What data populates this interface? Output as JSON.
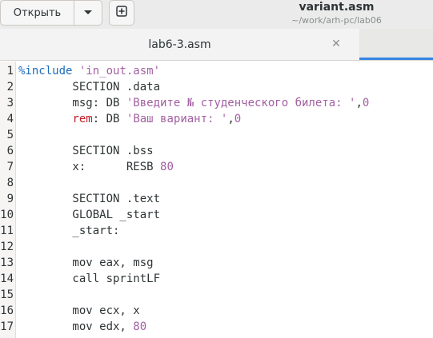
{
  "toolbar": {
    "open_label": "Открыть",
    "open_menu_icon": "chevron-down-icon",
    "new_tab_icon": "new-document-plus-icon"
  },
  "window": {
    "title": "variant.asm",
    "subtitle": "~/work/arh-pc/lab06"
  },
  "tabs": [
    {
      "label": "lab6-3.asm",
      "close_icon": "close-icon"
    }
  ],
  "editor": {
    "lines": [
      {
        "n": "1",
        "text": "%include 'in_out.asm'"
      },
      {
        "n": "2",
        "text": "        SECTION .data"
      },
      {
        "n": "3",
        "text": "        msg: DB 'Введите № студенческого билета: ',0"
      },
      {
        "n": "4",
        "text": "        rem: DB 'Ваш вариант: ',0"
      },
      {
        "n": "5",
        "text": ""
      },
      {
        "n": "6",
        "text": "        SECTION .bss"
      },
      {
        "n": "7",
        "text": "        x:      RESB 80"
      },
      {
        "n": "8",
        "text": ""
      },
      {
        "n": "9",
        "text": "        SECTION .text"
      },
      {
        "n": "10",
        "text": "        GLOBAL _start"
      },
      {
        "n": "11",
        "text": "        _start:"
      },
      {
        "n": "12",
        "text": ""
      },
      {
        "n": "13",
        "text": "        mov eax, msg"
      },
      {
        "n": "14",
        "text": "        call sprintLF"
      },
      {
        "n": "15",
        "text": ""
      },
      {
        "n": "16",
        "text": "        mov ecx, x"
      },
      {
        "n": "17",
        "text": "        mov edx, 80"
      }
    ]
  },
  "colors": {
    "accent": "#3584e4",
    "string": "#a25fa1",
    "preprocessor": "#1c6cbb",
    "rem_keyword": "#c01c28"
  }
}
